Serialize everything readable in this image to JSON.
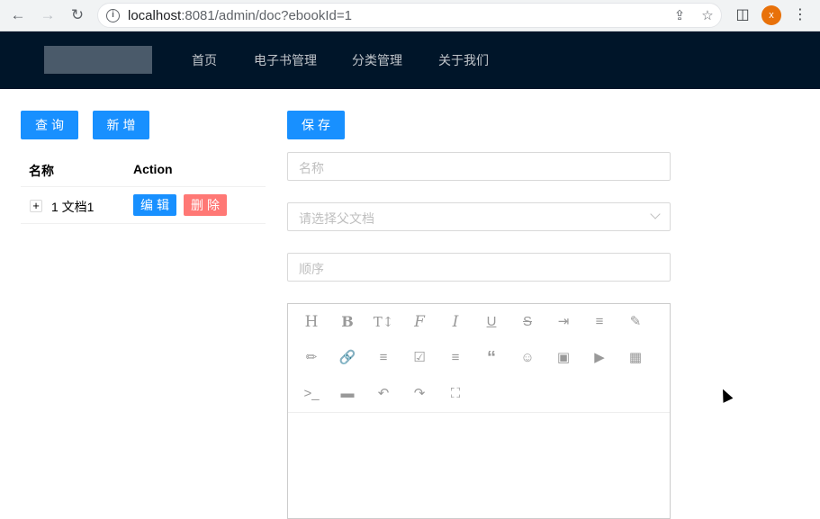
{
  "browser": {
    "url_host": "localhost",
    "url_rest": ":8081/admin/doc?ebookId=1",
    "profile_initial": "x"
  },
  "header": {
    "nav": [
      "首页",
      "电子书管理",
      "分类管理",
      "关于我们"
    ]
  },
  "left": {
    "query_button": "查询",
    "add_button": "新增",
    "columns": [
      "名称",
      "Action"
    ],
    "rows": [
      {
        "expand": "+",
        "name": "1 文档1",
        "edit": "编辑",
        "delete": "删除"
      }
    ]
  },
  "form": {
    "save_button": "保存",
    "name_placeholder": "名称",
    "parent_placeholder": "请选择父文档",
    "order_placeholder": "顺序"
  },
  "editor": {
    "toolbar_icons": [
      "heading-icon",
      "bold-icon",
      "font-size-icon",
      "font-family-icon",
      "italic-icon",
      "underline-icon",
      "strikethrough-icon",
      "indent-icon",
      "line-height-icon",
      "text-color-icon",
      "background-color-icon",
      "link-icon",
      "bulleted-list-icon",
      "todo-icon",
      "justify-icon",
      "quote-icon",
      "emoji-icon",
      "image-icon",
      "video-icon",
      "table-icon",
      "code-icon",
      "divider-icon",
      "undo-icon",
      "redo-icon",
      "fullscreen-icon"
    ]
  },
  "colors": {
    "primary": "#1890ff",
    "danger": "#ff7875",
    "header_bg": "#001529"
  }
}
